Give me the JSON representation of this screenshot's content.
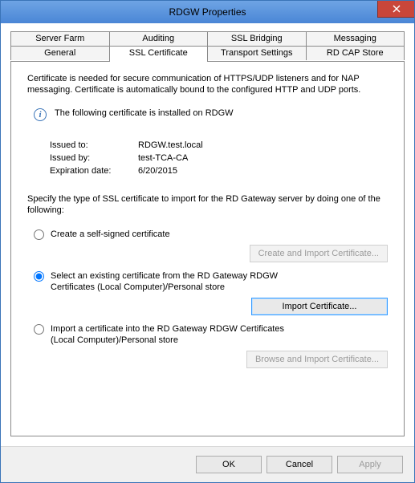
{
  "window": {
    "title": "RDGW Properties"
  },
  "tabs": {
    "row1": [
      "Server Farm",
      "Auditing",
      "SSL Bridging",
      "Messaging"
    ],
    "row2": [
      "General",
      "SSL Certificate",
      "Transport Settings",
      "RD CAP Store"
    ]
  },
  "intro": "Certificate is needed for secure communication of HTTPS/UDP listeners and for NAP messaging. Certificate is automatically bound to the configured HTTP and UDP ports.",
  "installed_msg": "The following certificate is installed on RDGW",
  "cert": {
    "issued_to_label": "Issued to:",
    "issued_to": "RDGW.test.local",
    "issued_by_label": "Issued by:",
    "issued_by": "test-TCA-CA",
    "exp_label": "Expiration date:",
    "exp": "6/20/2015"
  },
  "specify": "Specify the type of SSL certificate to import for the RD Gateway server by doing one of the following:",
  "options": {
    "create": "Create a self-signed certificate",
    "create_btn": "Create and Import Certificate...",
    "select": "Select an existing certificate from the RD Gateway RDGW Certificates (Local Computer)/Personal store",
    "select_btn": "Import Certificate...",
    "import": "Import a certificate into the RD Gateway RDGW Certificates (Local Computer)/Personal store",
    "import_btn": "Browse and Import Certificate..."
  },
  "footer": {
    "ok": "OK",
    "cancel": "Cancel",
    "apply": "Apply"
  }
}
